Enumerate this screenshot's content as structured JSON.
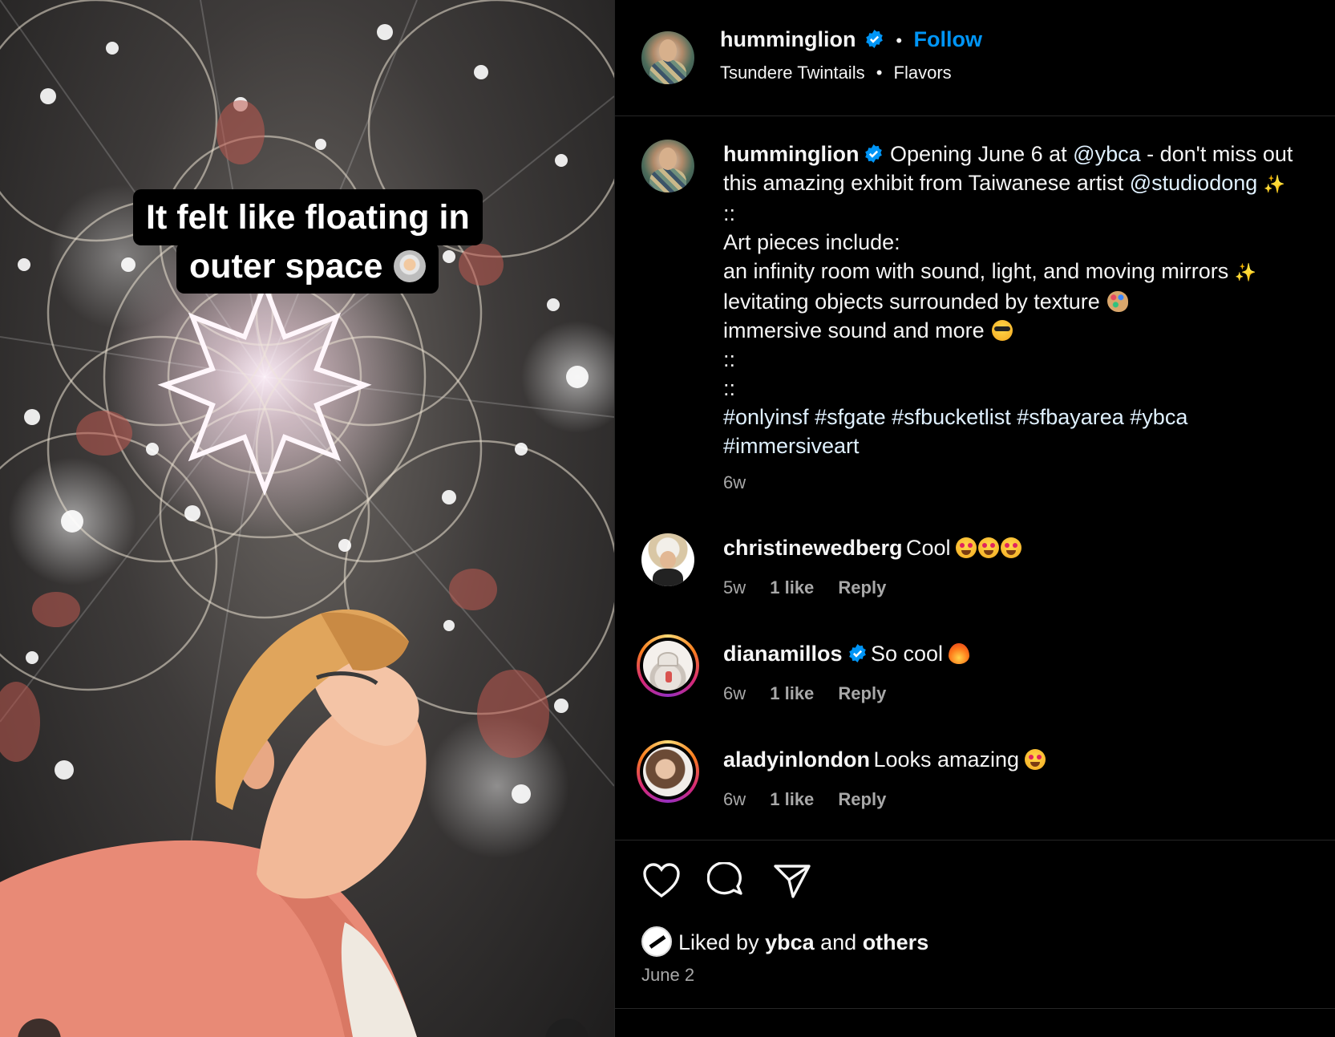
{
  "media": {
    "caption_line1": "It felt like floating in",
    "caption_line2": "outer space",
    "caption_emoji": "astronaut-emoji"
  },
  "header": {
    "username": "humminglion",
    "verified": true,
    "separator": "•",
    "follow_label": "Follow",
    "subline_left": "Tsundere Twintails",
    "subline_sep": "•",
    "subline_right": "Flavors"
  },
  "post_caption": {
    "username": "humminglion",
    "text_1": "Opening June 6 at ",
    "mention_1": "@ybca",
    "text_2": " - don't miss out",
    "text_3": "this amazing exhibit from Taiwanese artist ",
    "mention_2": "@studiodong",
    "sep_1": "::",
    "line_art": "Art pieces include:",
    "line_infinity": "an infinity room with sound, light, and moving mirrors",
    "line_levitating": "levitating objects surrounded by texture",
    "line_immersive": "immersive sound and more",
    "sep_2": "::",
    "sep_3": "::",
    "hashtags_1": "#onlyinsf #sfgate #sfbucketlist #sfbayarea #ybca",
    "hashtags_2": "#immersiveart",
    "age": "6w"
  },
  "comments": [
    {
      "username": "christinewedberg",
      "verified": false,
      "text": "Cool",
      "age": "5w",
      "likes": "1 like",
      "reply": "Reply"
    },
    {
      "username": "dianamillos",
      "verified": true,
      "text": "So cool",
      "age": "6w",
      "likes": "1 like",
      "reply": "Reply"
    },
    {
      "username": "aladyinlondon",
      "verified": false,
      "text": "Looks amazing",
      "age": "6w",
      "likes": "1 like",
      "reply": "Reply"
    }
  ],
  "footer": {
    "liked_prefix": "Liked by ",
    "liked_user": "ybca",
    "liked_mid": " and ",
    "liked_others": "others",
    "date": "June 2"
  },
  "colors": {
    "accent": "#0095f6",
    "background": "#000000",
    "muted_text": "#a8a8a8",
    "divider": "#262626"
  }
}
